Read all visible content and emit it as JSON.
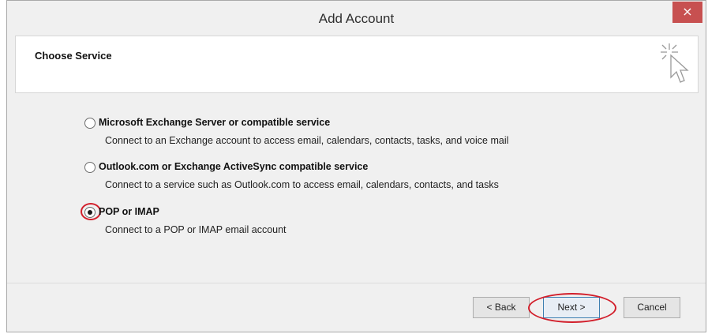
{
  "window": {
    "title": "Add Account",
    "close_label": "×"
  },
  "header": {
    "title": "Choose Service",
    "icon": "wizard-cursor-icon"
  },
  "options": [
    {
      "label": "Microsoft Exchange Server or compatible service",
      "description": "Connect to an Exchange account to access email, calendars, contacts, tasks, and voice mail",
      "selected": false
    },
    {
      "label": "Outlook.com or Exchange ActiveSync compatible service",
      "description": "Connect to a service such as Outlook.com to access email, calendars, contacts, and tasks",
      "selected": false
    },
    {
      "label": "POP or IMAP",
      "description": "Connect to a POP or IMAP email account",
      "selected": true
    }
  ],
  "buttons": {
    "back": "< Back",
    "next": "Next >",
    "cancel": "Cancel"
  },
  "colors": {
    "highlight": "#d21f2b",
    "close_bg": "#c75050"
  }
}
